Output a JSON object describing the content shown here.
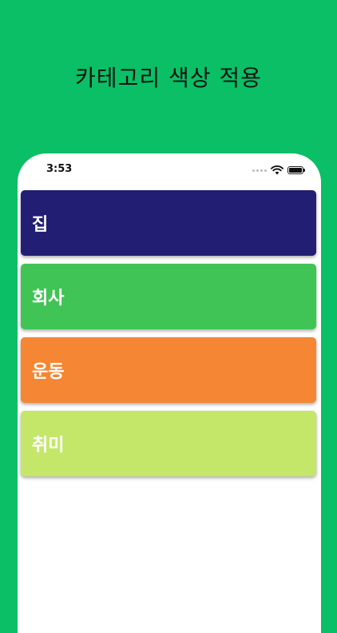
{
  "promo": {
    "title": "카테고리 색상 적용"
  },
  "status_bar": {
    "time": "3:53"
  },
  "categories": [
    {
      "label": "집",
      "color": "#221E74"
    },
    {
      "label": "회사",
      "color": "#40C456"
    },
    {
      "label": "운동",
      "color": "#F58634"
    },
    {
      "label": "취미",
      "color": "#C4E76A"
    }
  ]
}
